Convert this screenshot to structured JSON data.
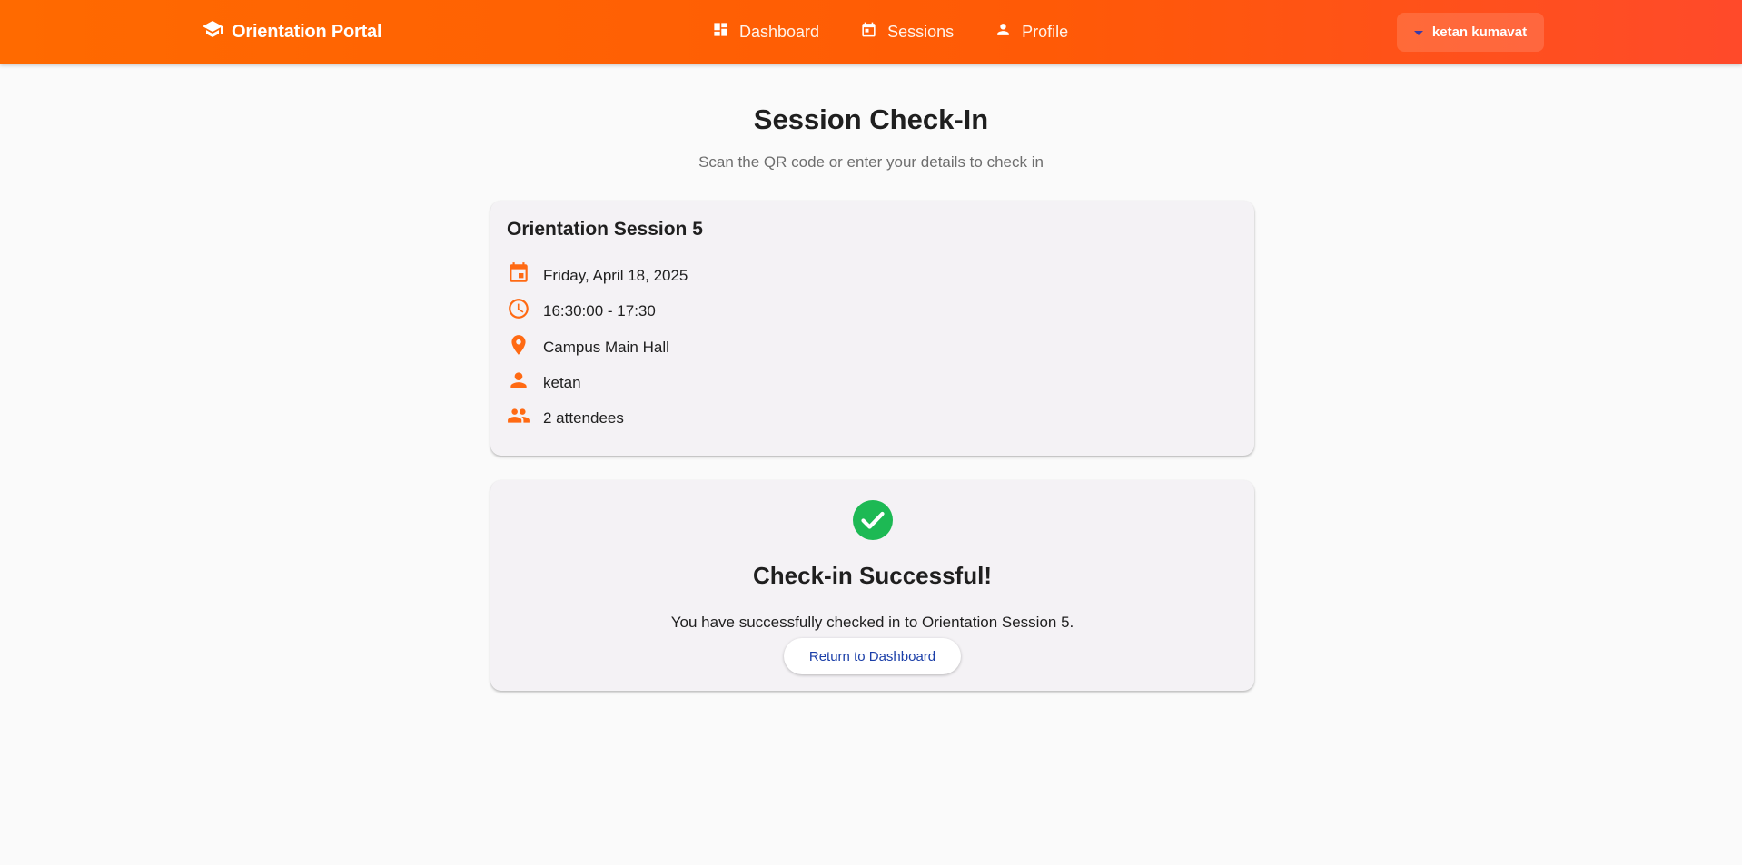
{
  "header": {
    "brand": "Orientation Portal",
    "nav": [
      {
        "label": "Dashboard",
        "icon": "dashboard-icon"
      },
      {
        "label": "Sessions",
        "icon": "calendar-icon"
      },
      {
        "label": "Profile",
        "icon": "person-icon"
      }
    ],
    "user_name": "ketan kumavat"
  },
  "main": {
    "title": "Session Check-In",
    "subtitle": "Scan the QR code or enter your details to check in"
  },
  "session": {
    "title": "Orientation Session 5",
    "date": "Friday, April 18, 2025",
    "time": "16:30:00 - 17:30",
    "location": "Campus Main Hall",
    "host": "ketan",
    "attendees": "2 attendees"
  },
  "success": {
    "title": "Check-in Successful!",
    "message": "You have successfully checked in to Orientation Session 5.",
    "button_label": "Return to Dashboard"
  },
  "colors": {
    "header_gradient_start": "#ff6a00",
    "header_gradient_end": "#ff4a2a",
    "accent_orange": "#ff6a13",
    "success_green": "#1db954",
    "button_text": "#1a3ea8"
  }
}
